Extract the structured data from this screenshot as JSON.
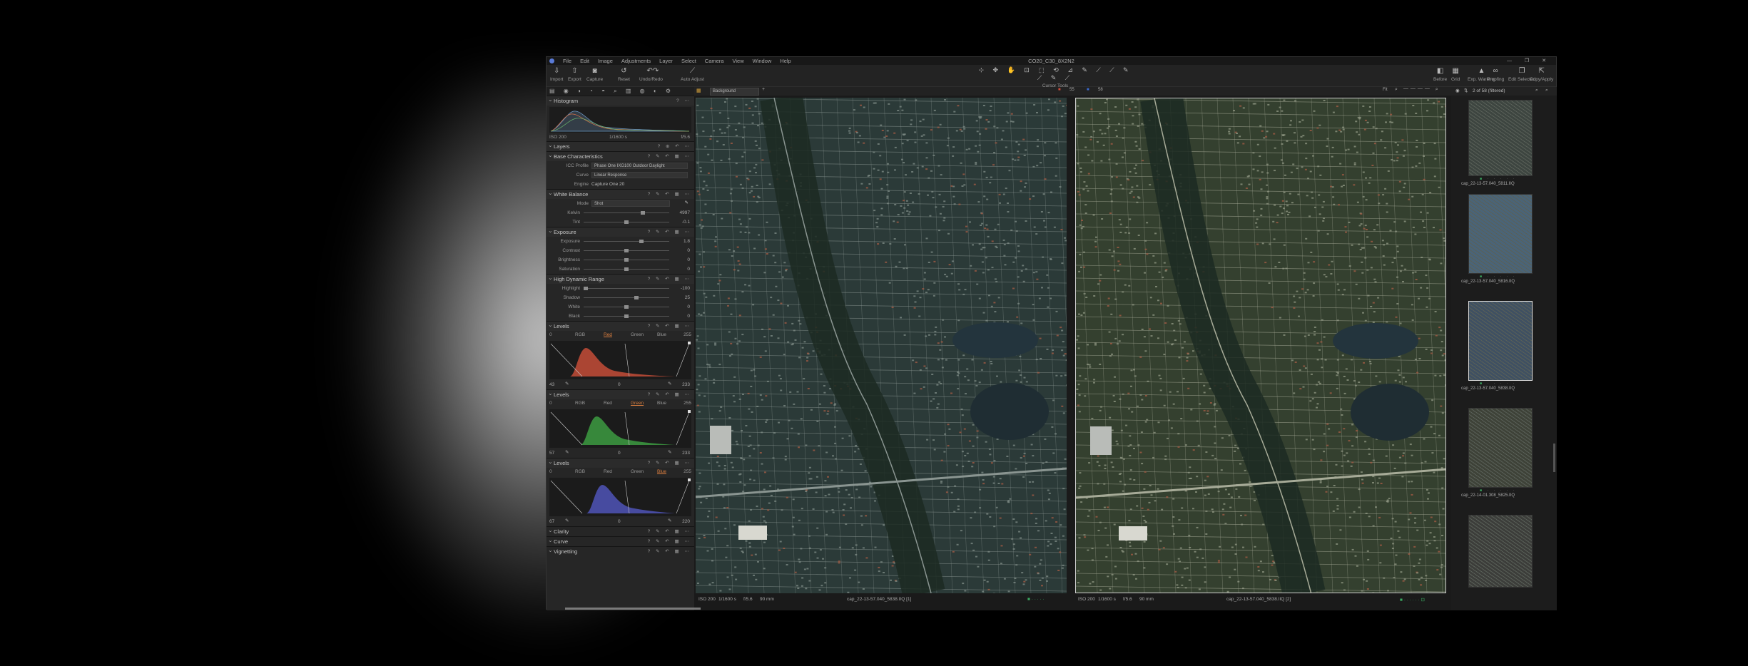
{
  "window": {
    "title": "CO20_C30_8X2N2",
    "menu": [
      "File",
      "Edit",
      "Image",
      "Adjustments",
      "Layer",
      "Select",
      "Camera",
      "View",
      "Window",
      "Help"
    ],
    "controls": "— ❐ ✕"
  },
  "toolbar": {
    "left": [
      {
        "label": "Import",
        "icon": "import-icon"
      },
      {
        "label": "Export",
        "icon": "export-icon"
      },
      {
        "label": "Capture",
        "icon": "camera-icon"
      },
      {
        "label": "Reset",
        "icon": "reset-icon"
      },
      {
        "label": "Undo/Redo",
        "icon": "undo-icon"
      },
      {
        "label": "Auto Adjust",
        "icon": "wand-icon"
      }
    ],
    "cursor_tools_label": "Cursor Tools",
    "cursor_tools_glyphs": "⊹ ✥ ✋ ⊡ ⬚ ⟲ ⊿ ✎ ⟋ ⟋ ✎ ⟋ ✎ ⟋",
    "right": [
      {
        "label": "Before",
        "icon": "before-after-icon"
      },
      {
        "label": "Grid",
        "icon": "grid-icon"
      },
      {
        "label": "Exp. Warning",
        "icon": "warning-icon"
      },
      {
        "label": "Proofing",
        "icon": "glasses-icon"
      },
      {
        "label": "Edit Selected",
        "icon": "edit-selected-icon"
      },
      {
        "label": "Copy/Apply",
        "icon": "copy-apply-icon"
      }
    ]
  },
  "left_panel": {
    "tool_tabs": "▤ ◉ ◑ ◔ ◓ ⌕ ▥ ◍ ◐ ⚙",
    "histogram": {
      "title": "Histogram",
      "iso": "ISO 200",
      "shutter": "1/1600 s",
      "aperture": "f/5.6"
    },
    "layers": {
      "title": "Layers"
    },
    "base": {
      "title": "Base Characteristics",
      "icc_label": "ICC Profile",
      "icc_value": "Phase One IXG100 Outdoor Daylight",
      "curve_label": "Curve",
      "curve_value": "Linear Response",
      "engine_label": "Engine",
      "engine_value": "Capture One 20"
    },
    "wb": {
      "title": "White Balance",
      "mode_label": "Mode",
      "mode_value": "Shot",
      "kelvin_label": "Kelvin",
      "kelvin_value": "4997",
      "tint_label": "Tint",
      "tint_value": "-0.1"
    },
    "exposure": {
      "title": "Exposure",
      "rows": [
        {
          "label": "Exposure",
          "value": "1.8",
          "pos": 0.68
        },
        {
          "label": "Contrast",
          "value": "0",
          "pos": 0.5
        },
        {
          "label": "Brightness",
          "value": "0",
          "pos": 0.5
        },
        {
          "label": "Saturation",
          "value": "0",
          "pos": 0.5
        }
      ]
    },
    "hdr": {
      "title": "High Dynamic Range",
      "rows": [
        {
          "label": "Highlight",
          "value": "-100",
          "pos": 0.0
        },
        {
          "label": "Shadow",
          "value": "25",
          "pos": 0.62
        },
        {
          "label": "White",
          "value": "0",
          "pos": 0.5
        },
        {
          "label": "Black",
          "value": "0",
          "pos": 0.5
        }
      ]
    },
    "levels": [
      {
        "title": "Levels",
        "left": "0",
        "right": "255",
        "active": "Red",
        "in_low": "43",
        "mid": "0",
        "in_high": "233",
        "color": "#d0503a"
      },
      {
        "title": "Levels",
        "left": "0",
        "right": "255",
        "active": "Green",
        "in_low": "57",
        "mid": "0",
        "in_high": "233",
        "color": "#3fa444"
      },
      {
        "title": "Levels",
        "left": "0",
        "right": "255",
        "active": "Blue",
        "in_low": "67",
        "mid": "0",
        "in_high": "220",
        "color": "#5358c2"
      }
    ],
    "level_tabs": [
      "RGB",
      "Red",
      "Green",
      "Blue"
    ],
    "footer_sections": [
      "Clarity",
      "Curve",
      "Vignetting"
    ]
  },
  "viewer": {
    "layer_select": "Background",
    "left_badge": "55",
    "right_badge": "58",
    "left_info": {
      "iso": "ISO 200",
      "shutter": "1/1600 s",
      "aperture": "f/5.6",
      "focal": "90 mm",
      "file": "cap_22-13-57.040_5838.IIQ [1]"
    },
    "right_info": {
      "iso": "ISO 200",
      "shutter": "1/1600 s",
      "aperture": "f/5.6",
      "focal": "90 mm",
      "file": "cap_22-13-57.040_5838.IIQ [2]"
    },
    "fit": "Fit"
  },
  "browser": {
    "count": "2 of 58 (filtered)",
    "items": [
      {
        "name": "cap_22-13-57.040_5811.IIQ"
      },
      {
        "name": "cap_22-13-57.040_5816.IIQ"
      },
      {
        "name": "cap_22-13-57.040_5838.IIQ"
      },
      {
        "name": "cap_22-14-01.308_5825.IIQ"
      },
      {
        "name": ""
      }
    ]
  }
}
